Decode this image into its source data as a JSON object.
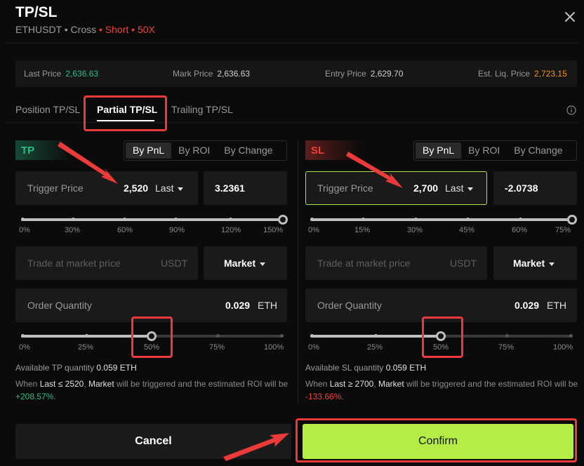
{
  "header": {
    "title": "TP/SL",
    "symbol": "ETHUSDT",
    "sep1": " • ",
    "margin_mode": "Cross",
    "sep2": " • ",
    "side": "Short",
    "sep3": " • ",
    "leverage": "50X"
  },
  "prices": {
    "last_label": "Last Price",
    "last_value": "2,636.63",
    "mark_label": "Mark Price",
    "mark_value": "2,636.63",
    "entry_label": "Entry Price",
    "entry_value": "2,629.70",
    "liq_label": "Est. Liq. Price",
    "liq_value": "2,723.15"
  },
  "tabs": [
    "Position TP/SL",
    "Partial TP/SL",
    "Trailing TP/SL"
  ],
  "mode_options": [
    "By PnL",
    "By ROI",
    "By Change"
  ],
  "tp": {
    "badge": "TP",
    "trigger_label": "Trigger Price",
    "trigger_value": "2,520",
    "trigger_source": "Last",
    "pnl_value": "3.2361",
    "pct_ticks": [
      "0%",
      "30%",
      "60%",
      "90%",
      "120%",
      "150%"
    ],
    "pct_level": 1.0,
    "trade_placeholder": "Trade at market price",
    "trade_unit": "USDT",
    "order_type": "Market",
    "qty_label": "Order Quantity",
    "qty_value": "0.029",
    "qty_unit": "ETH",
    "qty_ticks": [
      "0%",
      "25%",
      "50%",
      "75%",
      "100%"
    ],
    "qty_level": 0.5,
    "avail_label": "Available TP quantity",
    "avail_value": "0.059 ETH",
    "note_when": "When",
    "note_cond": "Last ≤ 2520",
    "note_type": "Market",
    "note_mid": "will be triggered and the estimated ROI will be",
    "note_roi": "+208.57%",
    "note_end": "."
  },
  "sl": {
    "badge": "SL",
    "trigger_label": "Trigger Price",
    "trigger_value": "2,700",
    "trigger_source": "Last",
    "pnl_value": "-2.0738",
    "pct_ticks": [
      "0%",
      "15%",
      "30%",
      "45%",
      "60%",
      "75%"
    ],
    "pct_level": 1.0,
    "trade_placeholder": "Trade at market price",
    "trade_unit": "USDT",
    "order_type": "Market",
    "qty_label": "Order Quantity",
    "qty_value": "0.029",
    "qty_unit": "ETH",
    "qty_ticks": [
      "0%",
      "25%",
      "50%",
      "75%",
      "100%"
    ],
    "qty_level": 0.5,
    "avail_label": "Available SL quantity",
    "avail_value": "0.059 ETH",
    "note_when": "When",
    "note_cond": "Last ≥ 2700",
    "note_type": "Market",
    "note_mid": "will be triggered and the estimated ROI will be",
    "note_roi": "-133.66%",
    "note_end": "."
  },
  "buttons": {
    "cancel": "Cancel",
    "confirm": "Confirm"
  },
  "colors": {
    "accent": "#b6ec46",
    "profit": "#2dbd85",
    "loss": "#f0403c",
    "liq": "#f7931a",
    "annotation": "#ea3a3a"
  }
}
